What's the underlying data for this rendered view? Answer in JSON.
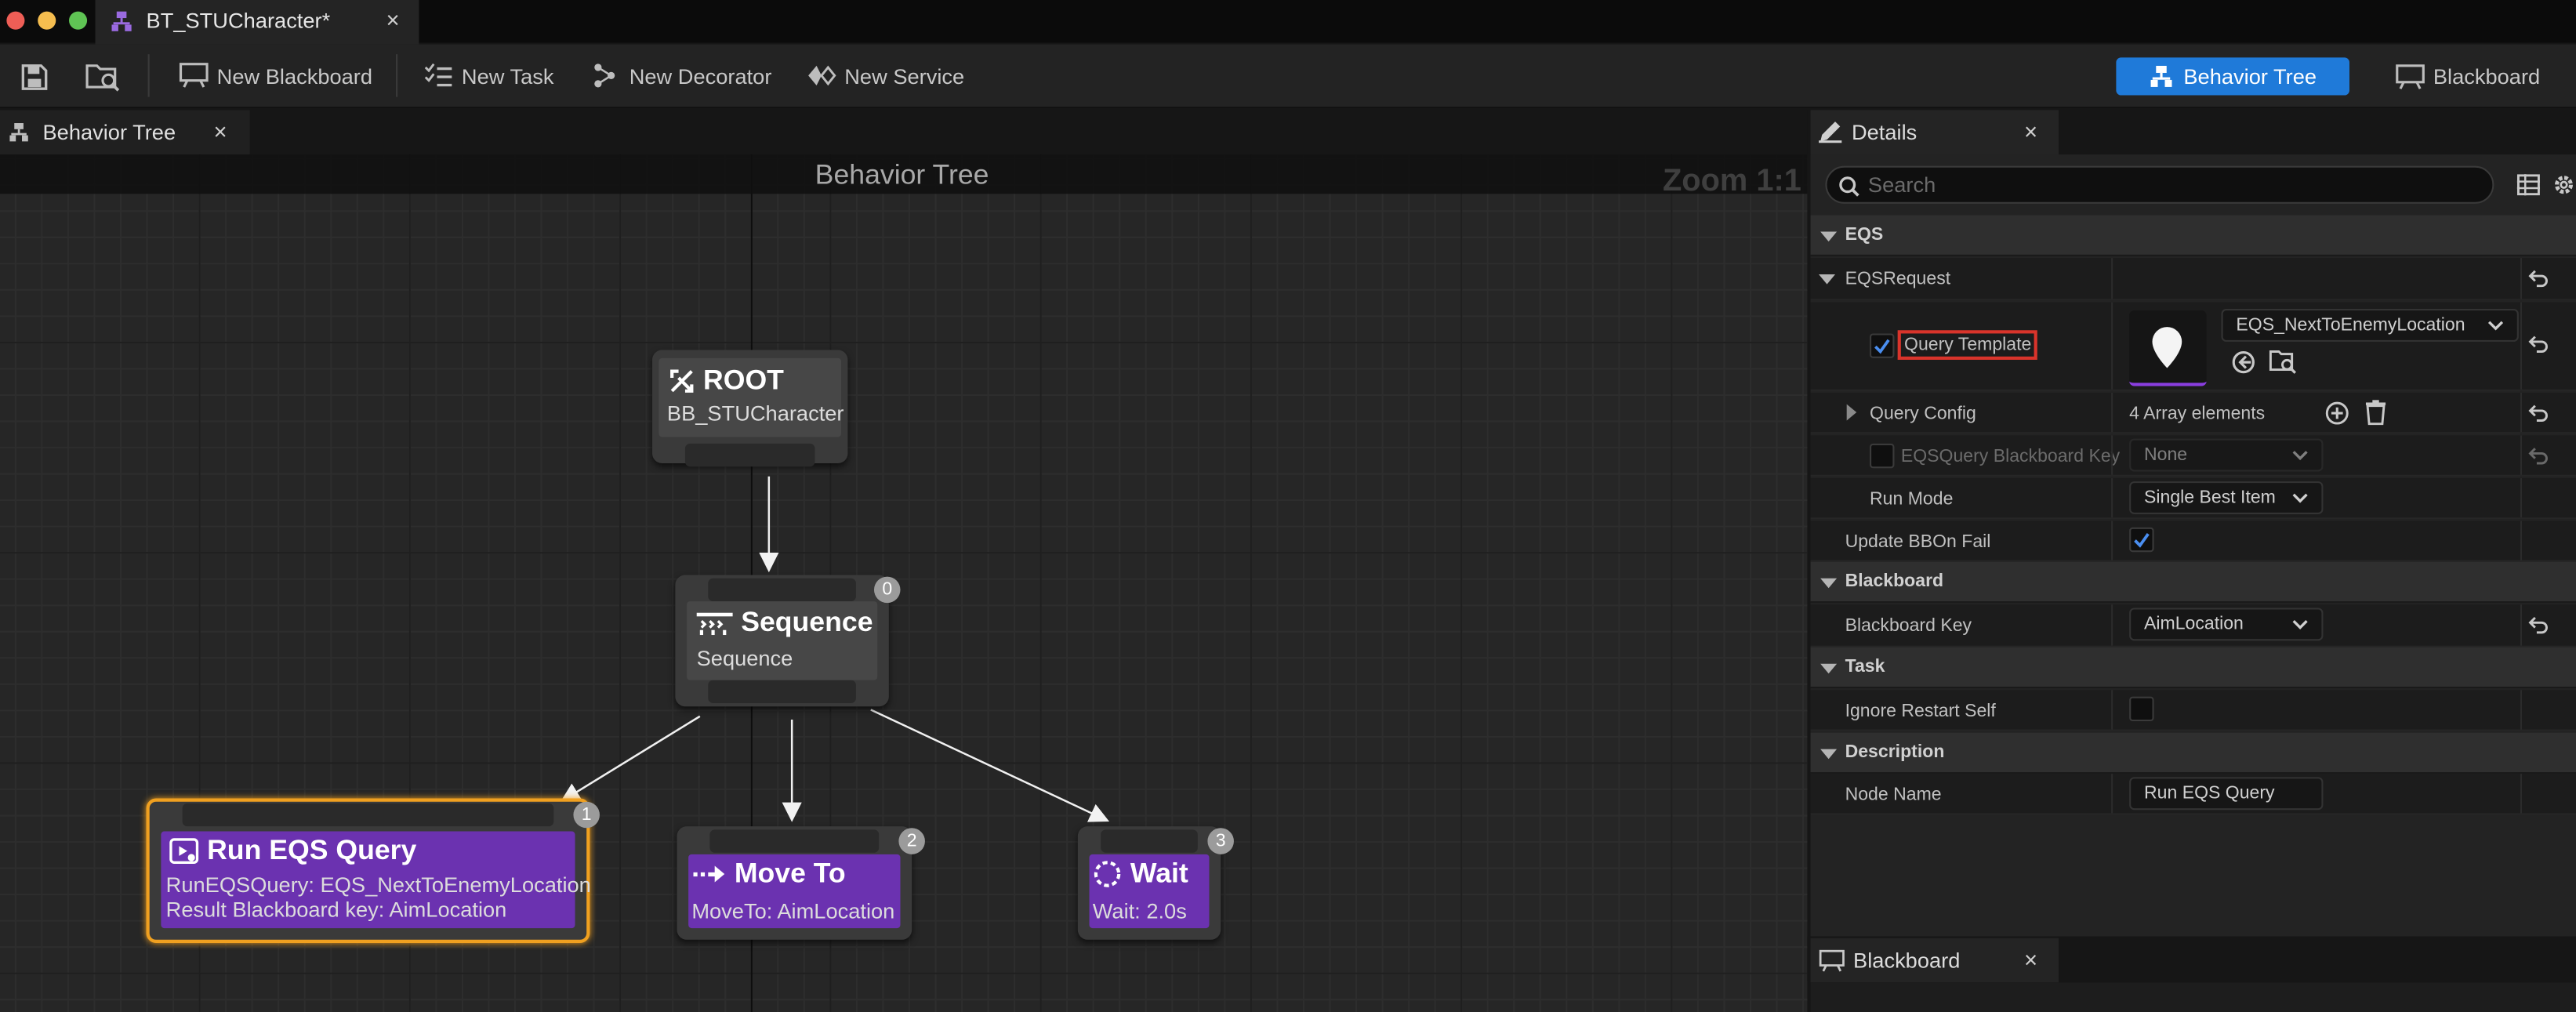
{
  "window": {
    "tab_title": "BT_STUCharacter*",
    "close_glyph": "×"
  },
  "toolbar": {
    "new_blackboard": "New Blackboard",
    "new_task": "New Task",
    "new_decorator": "New Decorator",
    "new_service": "New Service",
    "mode_behavior_tree": "Behavior Tree",
    "mode_blackboard": "Blackboard"
  },
  "graph": {
    "tab_label": "Behavior Tree",
    "title": "Behavior Tree",
    "zoom": "Zoom 1:1",
    "nodes": {
      "root": {
        "title": "ROOT",
        "subtitle": "BB_STUCharacter"
      },
      "sequence": {
        "title": "Sequence",
        "subtitle": "Sequence",
        "index": "0"
      },
      "run_eqs": {
        "title": "Run EQS Query",
        "line1": "RunEQSQuery: EQS_NextToEnemyLocation",
        "line2": "Result Blackboard key: AimLocation",
        "index": "1"
      },
      "move_to": {
        "title": "Move To",
        "subtitle": "MoveTo: AimLocation",
        "index": "2"
      },
      "wait": {
        "title": "Wait",
        "subtitle": "Wait: 2.0s",
        "index": "3"
      }
    }
  },
  "details": {
    "tab_label": "Details",
    "search_placeholder": "Search",
    "sections": {
      "eqs": "EQS",
      "blackboard": "Blackboard",
      "task": "Task",
      "description": "Description"
    },
    "eqs_request": "EQSRequest",
    "query_template_label": "Query Template",
    "query_template_value": "EQS_NextToEnemyLocation",
    "query_config_label": "Query Config",
    "query_config_value": "4 Array elements",
    "eqs_bb_key_label": "EQSQuery Blackboard Key",
    "eqs_bb_key_value": "None",
    "run_mode_label": "Run Mode",
    "run_mode_value": "Single Best Item",
    "update_bb_label": "Update BBOn Fail",
    "blackboard_key_label": "Blackboard Key",
    "blackboard_key_value": "AimLocation",
    "ignore_restart_label": "Ignore Restart Self",
    "node_name_label": "Node Name",
    "node_name_value": "Run EQS Query"
  },
  "blackboard_panel": {
    "tab_label": "Blackboard"
  },
  "colors": {
    "accent": "#1f7ad9",
    "task_purple": "#6b32b0",
    "selection_orange": "#f0a020",
    "highlight_red": "#d9342b"
  }
}
